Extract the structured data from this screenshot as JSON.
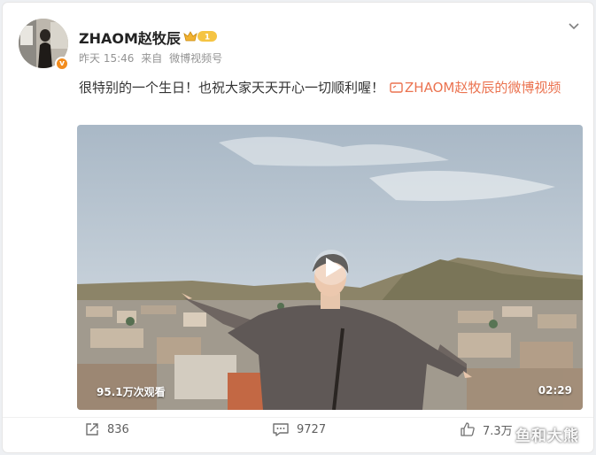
{
  "post": {
    "author": "ZHAOM赵牧辰",
    "vip_level": "1",
    "avatar_badge": "v",
    "time": "昨天 15:46",
    "source_prefix": "来自",
    "source": "微博视频号",
    "text": "很特别的一个生日！也祝大家天天开心一切顺利喔！",
    "link_text": "ZHAOM赵牧辰的微博视频",
    "link_icon": "video-icon"
  },
  "video": {
    "views": "95.1万次观看",
    "duration": "02:29"
  },
  "actions": {
    "share_count": "836",
    "comment_count": "9727",
    "like_count": "7.3万"
  },
  "watermark": "鱼和大熊",
  "colors": {
    "link": "#eb7350",
    "meta": "#939393",
    "vip_gold": "#f2b230"
  }
}
